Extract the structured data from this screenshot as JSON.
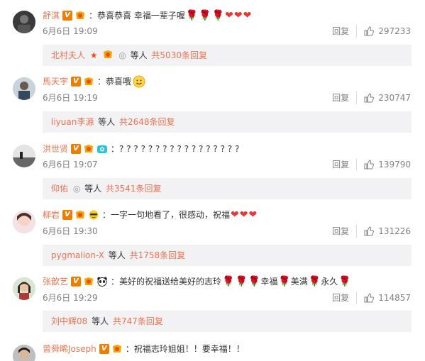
{
  "comments": [
    {
      "user": "舒淇",
      "text": "：恭喜恭喜 幸福一辈子喔",
      "date": "6月6日 19:09",
      "reply_label": "回复",
      "likes": "297233",
      "sub_users": "北村夫人",
      "sub_etc": "等人",
      "sub_total": "共5030条回复"
    },
    {
      "user": "馬天宇",
      "text": "：恭喜哦",
      "date": "6月6日 19:19",
      "reply_label": "回复",
      "likes": "230747",
      "sub_users": "liyuan李源",
      "sub_etc": "等人",
      "sub_total": "共2648条回复"
    },
    {
      "user": "洪世贤",
      "text": "：? ? ? ? ? ? ? ? ? ? ? ? ? ? ? ? ?",
      "date": "6月6日 19:07",
      "reply_label": "回复",
      "likes": "139790",
      "sub_users": "仰佑",
      "sub_etc": "等人",
      "sub_total": "共3541条回复"
    },
    {
      "user": "柳岩",
      "text": "：一字一句地看了，很感动，祝福",
      "date": "6月6日 19:30",
      "reply_label": "回复",
      "likes": "131226",
      "sub_users": "pygmalion-X",
      "sub_etc": "等人",
      "sub_total": "共1758条回复"
    },
    {
      "user": "张歆艺",
      "text_a": "：美好的祝福送给美好的志玲",
      "text_b": "幸福",
      "text_c": "美满",
      "text_d": "永久",
      "date": "6月6日 19:29",
      "reply_label": "回复",
      "likes": "114857",
      "sub_users": "刘中辉08",
      "sub_etc": "等人",
      "sub_total": "共747条回复"
    },
    {
      "user": "曾舜晞Joseph",
      "text": "：祝福志玲姐姐！！要幸福！！"
    }
  ],
  "colors": {
    "username": "#eb7350",
    "meta": "#808080",
    "subbox": "#f2f2f5"
  },
  "icons": [
    "rose-emoji",
    "heart-emoji",
    "smile-emoji",
    "like-icon",
    "verified-badge",
    "vip-badge"
  ]
}
